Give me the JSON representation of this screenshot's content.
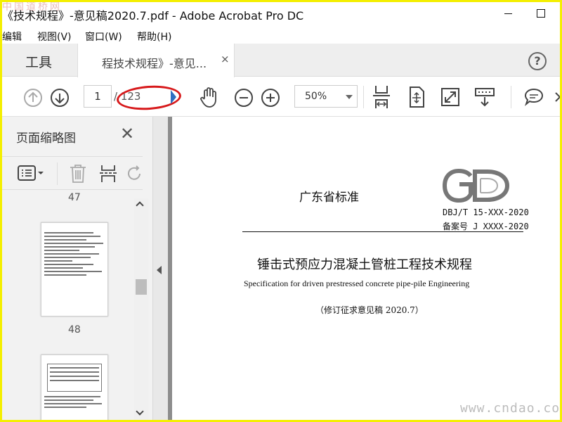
{
  "window": {
    "title": "《技术规程》-意见稿2020.7.pdf - Adobe Acrobat Pro DC",
    "watermark_top": "中国道桥网"
  },
  "menu": {
    "items": [
      "编辑",
      "视图(V)",
      "窗口(W)",
      "帮助(H)"
    ]
  },
  "tabs": {
    "tools_label": "工具",
    "doc_label": "程技术规程》-意见...",
    "close_glyph": "×",
    "help_glyph": "?"
  },
  "toolbar": {
    "page_current": "1",
    "page_total": "/ 123",
    "zoom": "50%"
  },
  "panel": {
    "title": "页面缩略图",
    "close_glyph": "✕",
    "thumb_labels": [
      "47",
      "48"
    ]
  },
  "document": {
    "standard_name": "广东省标准",
    "standard_code": "DBJ/T 15-XXX-2020",
    "record_no": "备案号 J XXXX-2020",
    "title_cn": "锤击式预应力混凝土管桩工程技术规程",
    "title_en": "Specification for driven prestressed concrete pipe-pile Engineering",
    "note": "（修订征求意见稿 2020.7）",
    "logo_text": "GD"
  },
  "watermark_bottom": "www.cndao.com",
  "colors": {
    "frame": "#f4ef00",
    "annotation": "#d7191b",
    "panel_bg": "#f2f2f2",
    "next_arrow": "#2f6fc1"
  },
  "icons": [
    "prev-page-icon",
    "next-page-icon",
    "hand-tool-icon",
    "zoom-out-icon",
    "zoom-in-icon",
    "fit-page-icon",
    "full-screen-icon",
    "read-mode-icon",
    "comment-icon",
    "options-icon",
    "delete-icon",
    "insert-page-icon",
    "undo-icon"
  ]
}
